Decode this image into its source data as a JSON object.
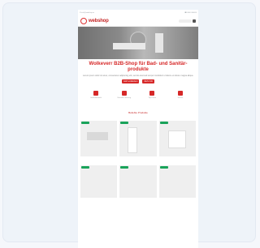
{
  "site": {
    "topline_left": "✉ info@webshop.xx",
    "topline_right": "☎ 0000 000000",
    "logo_text": "webshop",
    "search_placeholder": "",
    "hero_title": "Wolkeverr B2B-Shop für Bad- und Sanitär-produkte",
    "hero_desc": "Lorem ipsum dolor sit amet, consectetur adipiscing elit, sed do eiusmod tempor incididunt ut labore et dolore magna aliqua.",
    "button_primary": "Jetzt entdecken",
    "button_secondary": "Mehr Info",
    "features": [
      {
        "text": "Große Auswahl"
      },
      {
        "text": "Schnelle Lieferung"
      },
      {
        "text": "Top Preise"
      },
      {
        "text": "Service"
      }
    ],
    "products_title": "Beliebte Produkte"
  },
  "colors": {
    "brand_red": "#d62828",
    "badge_green": "#19a35a"
  }
}
